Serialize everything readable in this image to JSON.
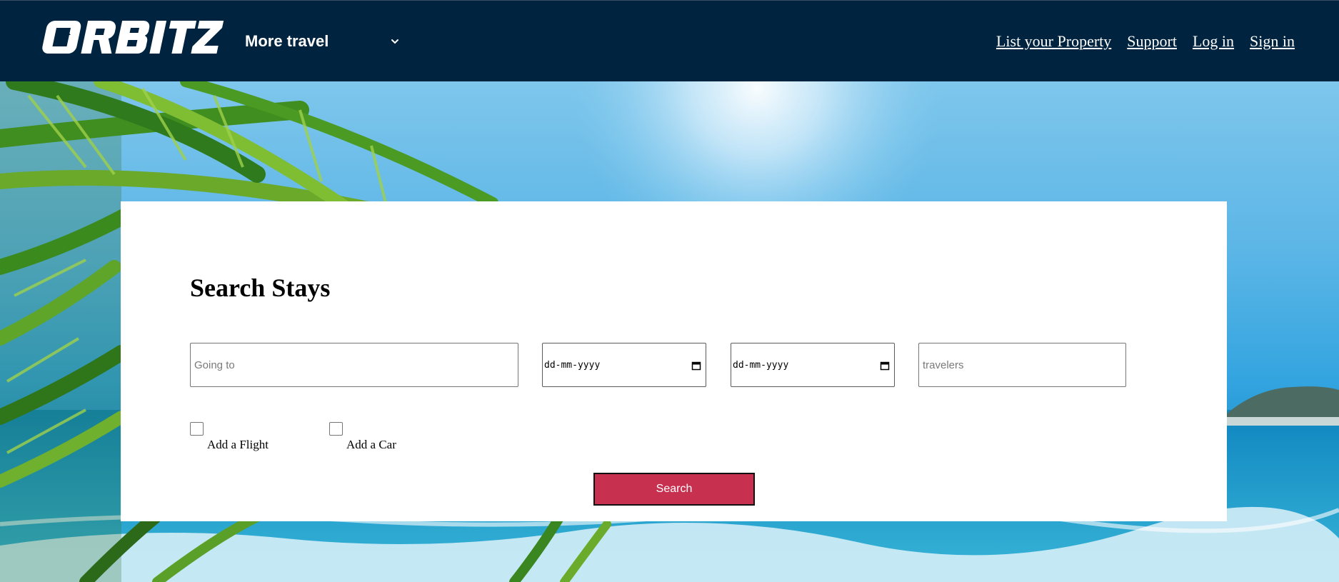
{
  "header": {
    "logo_text": "ORBITZ",
    "more_travel_label": "More travel",
    "nav": [
      {
        "label": "List your Property"
      },
      {
        "label": "Support"
      },
      {
        "label": "Log in"
      },
      {
        "label": "Sign in"
      }
    ]
  },
  "search": {
    "title": "Search Stays",
    "destination": {
      "placeholder": "Going to",
      "value": ""
    },
    "checkin": {
      "placeholder": "dd-mm-yyyy"
    },
    "checkout": {
      "placeholder": "dd-mm-yyyy"
    },
    "travelers": {
      "placeholder": "travelers",
      "value": ""
    },
    "add_flight_label": "Add a Flight",
    "add_car_label": "Add a Car",
    "add_flight_checked": false,
    "add_car_checked": false,
    "button_label": "Search"
  },
  "colors": {
    "header_bg": "#00243f",
    "button_bg": "#c8304f",
    "card_bg": "#ffffff"
  }
}
